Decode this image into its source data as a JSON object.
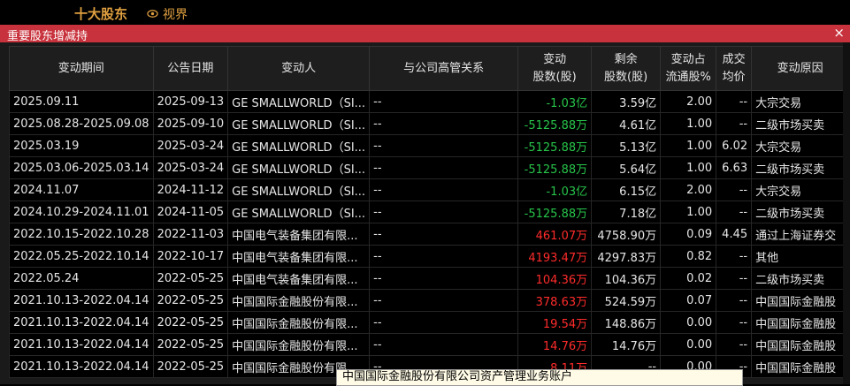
{
  "topbar": {
    "title": "十大股东",
    "link": "视界"
  },
  "panel": {
    "title": "重要股东增减持",
    "close": "×"
  },
  "columns": [
    {
      "l1": "变动期间",
      "l2": ""
    },
    {
      "l1": "公告日期",
      "l2": ""
    },
    {
      "l1": "变动人",
      "l2": ""
    },
    {
      "l1": "与公司高管关系",
      "l2": ""
    },
    {
      "l1": "变动",
      "l2": "股数(股)"
    },
    {
      "l1": "剩余",
      "l2": "股数(股)"
    },
    {
      "l1": "变动占",
      "l2": "流通股%"
    },
    {
      "l1": "成交",
      "l2": "均价"
    },
    {
      "l1": "变动原因",
      "l2": ""
    }
  ],
  "rows": [
    {
      "period": "2025.09.11",
      "date": "2025-09-13",
      "person": "GE SMALLWORLD（SI...",
      "relation": "--",
      "change": "-1.03亿",
      "remain": "3.59亿",
      "pct": "2.00",
      "price": "--",
      "reason": "大宗交易",
      "dir": "neg"
    },
    {
      "period": "2025.08.28-2025.09.08",
      "date": "2025-09-10",
      "person": "GE SMALLWORLD（SI...",
      "relation": "--",
      "change": "-5125.88万",
      "remain": "4.61亿",
      "pct": "1.00",
      "price": "--",
      "reason": "二级市场买卖",
      "dir": "neg"
    },
    {
      "period": "2025.03.19",
      "date": "2025-03-24",
      "person": "GE SMALLWORLD（SI...",
      "relation": "--",
      "change": "-5125.88万",
      "remain": "5.13亿",
      "pct": "1.00",
      "price": "6.02",
      "reason": "大宗交易",
      "dir": "neg"
    },
    {
      "period": "2025.03.06-2025.03.14",
      "date": "2025-03-24",
      "person": "GE SMALLWORLD（SI...",
      "relation": "--",
      "change": "-5125.88万",
      "remain": "5.64亿",
      "pct": "1.00",
      "price": "6.63",
      "reason": "二级市场买卖",
      "dir": "neg"
    },
    {
      "period": "2024.11.07",
      "date": "2024-11-12",
      "person": "GE SMALLWORLD（SI...",
      "relation": "--",
      "change": "-1.03亿",
      "remain": "6.15亿",
      "pct": "2.00",
      "price": "--",
      "reason": "大宗交易",
      "dir": "neg"
    },
    {
      "period": "2024.10.29-2024.11.01",
      "date": "2024-11-05",
      "person": "GE SMALLWORLD（SI...",
      "relation": "--",
      "change": "-5125.88万",
      "remain": "7.18亿",
      "pct": "1.00",
      "price": "--",
      "reason": "二级市场买卖",
      "dir": "neg"
    },
    {
      "period": "2022.10.15-2022.10.28",
      "date": "2022-11-03",
      "person": "中国电气装备集团有限...",
      "relation": "--",
      "change": "461.07万",
      "remain": "4758.90万",
      "pct": "0.09",
      "price": "4.45",
      "reason": "通过上海证券交",
      "dir": "pos"
    },
    {
      "period": "2022.05.25-2022.10.14",
      "date": "2022-10-17",
      "person": "中国电气装备集团有限...",
      "relation": "--",
      "change": "4193.47万",
      "remain": "4297.83万",
      "pct": "0.82",
      "price": "--",
      "reason": "其他",
      "dir": "pos"
    },
    {
      "period": "2022.05.24",
      "date": "2022-05-25",
      "person": "中国电气装备集团有限...",
      "relation": "--",
      "change": "104.36万",
      "remain": "104.36万",
      "pct": "0.02",
      "price": "--",
      "reason": "二级市场买卖",
      "dir": "pos"
    },
    {
      "period": "2021.10.13-2022.04.14",
      "date": "2022-05-25",
      "person": "中国国际金融股份有限...",
      "relation": "--",
      "change": "378.63万",
      "remain": "524.59万",
      "pct": "0.07",
      "price": "--",
      "reason": "中国国际金融股",
      "dir": "pos"
    },
    {
      "period": "2021.10.13-2022.04.14",
      "date": "2022-05-25",
      "person": "中国国际金融股份有限...",
      "relation": "--",
      "change": "19.54万",
      "remain": "148.86万",
      "pct": "0.00",
      "price": "--",
      "reason": "中国国际金融股",
      "dir": "pos"
    },
    {
      "period": "2021.10.13-2022.04.14",
      "date": "2022-05-25",
      "person": "中国国际金融股份有限...",
      "relation": "--",
      "change": "14.76万",
      "remain": "14.76万",
      "pct": "0.00",
      "price": "--",
      "reason": "中国国际金融股",
      "dir": "pos"
    },
    {
      "period": "2021.10.13-2022.04.14",
      "date": "2022-05-25",
      "person": "中国国际金融股份有限...",
      "relation": "--",
      "change": "8.11万",
      "remain": "--",
      "pct": "0.00",
      "price": "--",
      "reason": "中国国际金融股",
      "dir": "pos"
    }
  ],
  "tooltip": "中国国际金融股份有限公司资产管理业务账户"
}
